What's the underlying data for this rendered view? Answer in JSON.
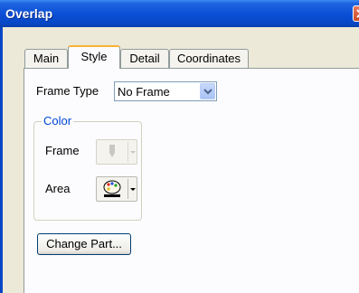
{
  "window": {
    "title": "Overlap"
  },
  "tabs": [
    {
      "label": "Main",
      "selected": false
    },
    {
      "label": "Style",
      "selected": true
    },
    {
      "label": "Detail",
      "selected": false
    },
    {
      "label": "Coordinates",
      "selected": false
    }
  ],
  "style": {
    "frame_type_label": "Frame Type",
    "frame_type_value": "No Frame",
    "color_group_label": "Color",
    "frame_label": "Frame",
    "area_label": "Area",
    "change_part_label": "Change Part..."
  },
  "icons": {
    "frame_color": "pen-icon",
    "area_color": "palette-icon",
    "dropdown": "chevron-down-icon"
  },
  "colors": {
    "titlebar": "#0a4fd6",
    "active_tab_accent": "#f8b234",
    "group_label": "#0046d5"
  }
}
